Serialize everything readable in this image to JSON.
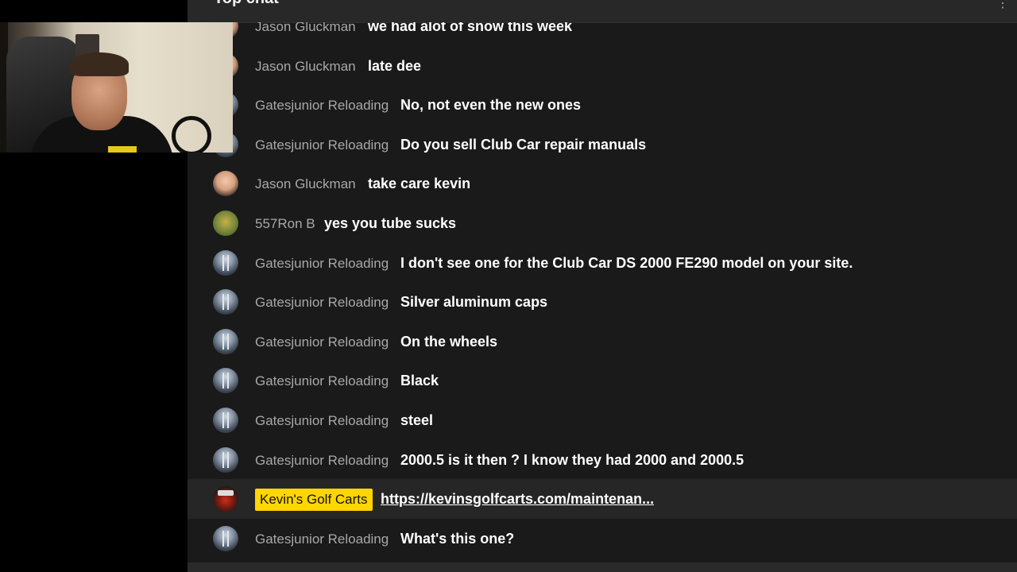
{
  "chat": {
    "title": "Top chat",
    "messages": [
      {
        "author": "Jason Gluckman",
        "text": "we had alot of snow this week",
        "avatar": "face"
      },
      {
        "author": "Jason Gluckman",
        "text": "late dee",
        "avatar": "face"
      },
      {
        "author": "Gatesjunior Reloading",
        "text": "No, not even the new ones",
        "avatar": "robot"
      },
      {
        "author": "Gatesjunior Reloading",
        "text": "Do you sell Club Car repair manuals",
        "avatar": "robot"
      },
      {
        "author": "Jason Gluckman",
        "text": "take care kevin",
        "avatar": "face"
      },
      {
        "author": "557Ron B",
        "text": "yes you tube sucks",
        "avatar": "ron"
      },
      {
        "author": "Gatesjunior Reloading",
        "text": "I don't see one for the Club Car DS 2000 FE290 model on your site.",
        "avatar": "robot"
      },
      {
        "author": "Gatesjunior Reloading",
        "text": "Silver aluminum caps",
        "avatar": "robot"
      },
      {
        "author": "Gatesjunior Reloading",
        "text": "On the wheels",
        "avatar": "robot"
      },
      {
        "author": "Gatesjunior Reloading",
        "text": "Black",
        "avatar": "robot"
      },
      {
        "author": "Gatesjunior Reloading",
        "text": "steel",
        "avatar": "robot"
      },
      {
        "author": "Gatesjunior Reloading",
        "text": "2000.5 is it then ? I know they had 2000 and 2000.5",
        "avatar": "robot"
      },
      {
        "author": "Kevin's Golf Carts",
        "text": "https://kevinsgolfcarts.com/maintenan...",
        "avatar": "cart",
        "owner": true
      },
      {
        "author": "Gatesjunior Reloading",
        "text": "What's this one?",
        "avatar": "robot"
      }
    ]
  },
  "colors": {
    "chat_bg": "#1a1a1a",
    "owner_badge": "#ffd600",
    "author_text": "#a8a8a8",
    "message_text": "#ffffff"
  }
}
